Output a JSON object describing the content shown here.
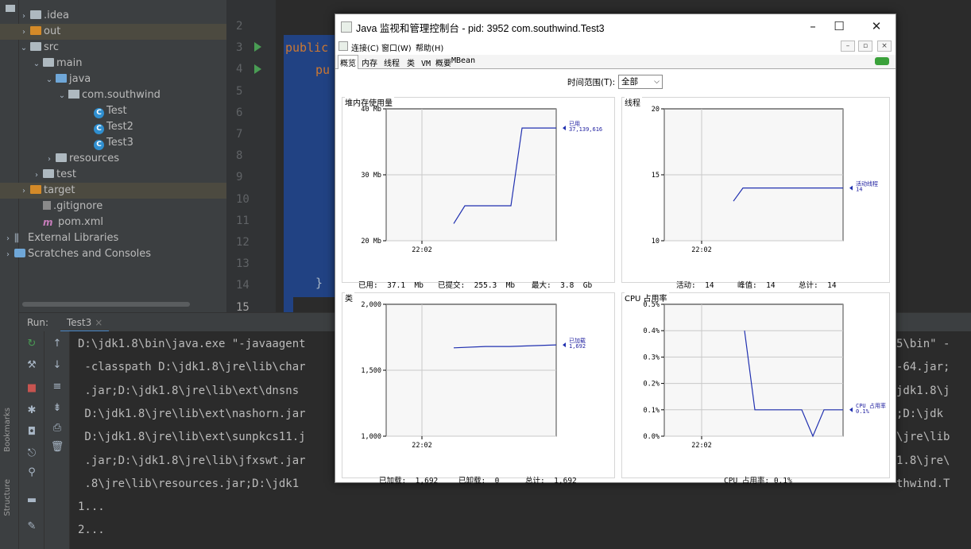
{
  "project_tree": {
    "items": [
      {
        "label": ".idea",
        "icon": "folder-icon",
        "arrow": ">"
      },
      {
        "label": "out",
        "icon": "folder-orange-icon",
        "arrow": ">"
      },
      {
        "label": "src",
        "icon": "folder-icon",
        "arrow": "v"
      },
      {
        "label": "main",
        "icon": "folder-icon",
        "arrow": "v"
      },
      {
        "label": "java",
        "icon": "folder-blue-icon",
        "arrow": "v"
      },
      {
        "label": "com.southwind",
        "icon": "package-icon",
        "arrow": "v"
      },
      {
        "label": "Test",
        "icon": "class-icon",
        "arrow": ""
      },
      {
        "label": "Test2",
        "icon": "class-icon",
        "arrow": ""
      },
      {
        "label": "Test3",
        "icon": "class-icon",
        "arrow": ""
      },
      {
        "label": "resources",
        "icon": "resources-folder-icon",
        "arrow": ">"
      },
      {
        "label": "test",
        "icon": "folder-icon",
        "arrow": ">"
      },
      {
        "label": "target",
        "icon": "folder-orange-icon",
        "arrow": ">"
      },
      {
        "label": ".gitignore",
        "icon": "gitignore-icon",
        "arrow": ""
      },
      {
        "label": "pom.xml",
        "icon": "maven-icon",
        "arrow": ""
      },
      {
        "label": "External Libraries",
        "icon": "libraries-icon",
        "arrow": ">"
      },
      {
        "label": "Scratches and Consoles",
        "icon": "scratches-icon",
        "arrow": ">"
      }
    ]
  },
  "editor": {
    "line_numbers": [
      "2",
      "3",
      "4",
      "5",
      "6",
      "7",
      "8",
      "9",
      "10",
      "11",
      "12",
      "13",
      "14",
      "15"
    ],
    "code_public1": "public",
    "code_pub2": "pu",
    "code_brace": "}"
  },
  "run_panel": {
    "label": "Run:",
    "tab": "Test3",
    "console_lines": [
      "D:\\jdk1.8\\bin\\java.exe \"-javaagent",
      " -classpath D:\\jdk1.8\\jre\\lib\\char",
      " .jar;D:\\jdk1.8\\jre\\lib\\ext\\dnsns",
      " D:\\jdk1.8\\jre\\lib\\ext\\nashorn.jar",
      " D:\\jdk1.8\\jre\\lib\\ext\\sunpkcs11.j",
      " .jar;D:\\jdk1.8\\jre\\lib\\jfxswt.jar",
      " .8\\jre\\lib\\resources.jar;D:\\jdk1",
      "1...",
      "2..."
    ],
    "console_right": [
      "5\\bin\" -",
      "-64.jar;",
      "jdk1.8\\j",
      ";D:\\jdk",
      "\\jre\\lib",
      "1.8\\jre\\",
      "thwind.T"
    ],
    "side_labels": {
      "bookmarks": "Bookmarks",
      "structure": "Structure"
    }
  },
  "jconsole": {
    "title": "Java 监视和管理控制台 - pid: 3952 com.southwind.Test3",
    "menu": [
      "连接(C)",
      "窗口(W)",
      "帮助(H)"
    ],
    "tabs": [
      "概览",
      "内存",
      "线程",
      "类",
      "VM 概要",
      "MBean"
    ],
    "active_tab": "概览",
    "time_range_label": "时间范围(T):",
    "time_range_value": "全部",
    "panels": {
      "heap": {
        "title": "堆内存使用量",
        "legend_name": "已用",
        "legend_value": "37,139,616",
        "stats": [
          "已用:  37.1  Mb",
          "已提交:  255.3  Mb",
          "最大:  3.8  Gb"
        ]
      },
      "threads": {
        "title": "线程",
        "legend_name": "活动线程",
        "legend_value": "14",
        "stats": [
          "活动:  14",
          "峰值:  14",
          "总计:  14"
        ]
      },
      "classes": {
        "title": "类",
        "legend_name": "已加载",
        "legend_value": "1,692",
        "stats": [
          "已加载:  1,692",
          "已卸载:  0",
          "总计:  1,692"
        ]
      },
      "cpu": {
        "title": "CPU 占用率",
        "legend_name": "CPU 占用率",
        "legend_value": "0.1%",
        "stats": [
          "CPU 占用率: 0.1%"
        ]
      }
    }
  },
  "chart_data": [
    {
      "type": "line",
      "title": "堆内存使用量",
      "ylabel": "",
      "y_ticks": [
        "20 Mb",
        "30 Mb",
        "40 Mb"
      ],
      "ylim": [
        20,
        40
      ],
      "x_ticks": [
        "22:02"
      ],
      "series": [
        {
          "name": "已用",
          "values": [
            22.6,
            25.3,
            25.3,
            37.1,
            37.1
          ]
        }
      ]
    },
    {
      "type": "line",
      "title": "线程",
      "y_ticks": [
        "10",
        "15",
        "20"
      ],
      "ylim": [
        10,
        20
      ],
      "x_ticks": [
        "22:02"
      ],
      "series": [
        {
          "name": "活动线程",
          "values": [
            13,
            14,
            14,
            14
          ]
        }
      ]
    },
    {
      "type": "line",
      "title": "类",
      "y_ticks": [
        "1,000",
        "1,500",
        "2,000"
      ],
      "ylim": [
        1000,
        2000
      ],
      "x_ticks": [
        "22:02"
      ],
      "series": [
        {
          "name": "已加载",
          "values": [
            1670,
            1680,
            1680,
            1692
          ]
        }
      ]
    },
    {
      "type": "line",
      "title": "CPU 占用率",
      "y_ticks": [
        "0.0%",
        "0.1%",
        "0.2%",
        "0.3%",
        "0.4%",
        "0.5%"
      ],
      "ylim": [
        0,
        0.5
      ],
      "x_ticks": [
        "22:02"
      ],
      "series": [
        {
          "name": "CPU 占用率",
          "values": [
            0.4,
            0.1,
            0.1,
            0.0,
            0.1,
            0.1
          ]
        }
      ]
    }
  ]
}
